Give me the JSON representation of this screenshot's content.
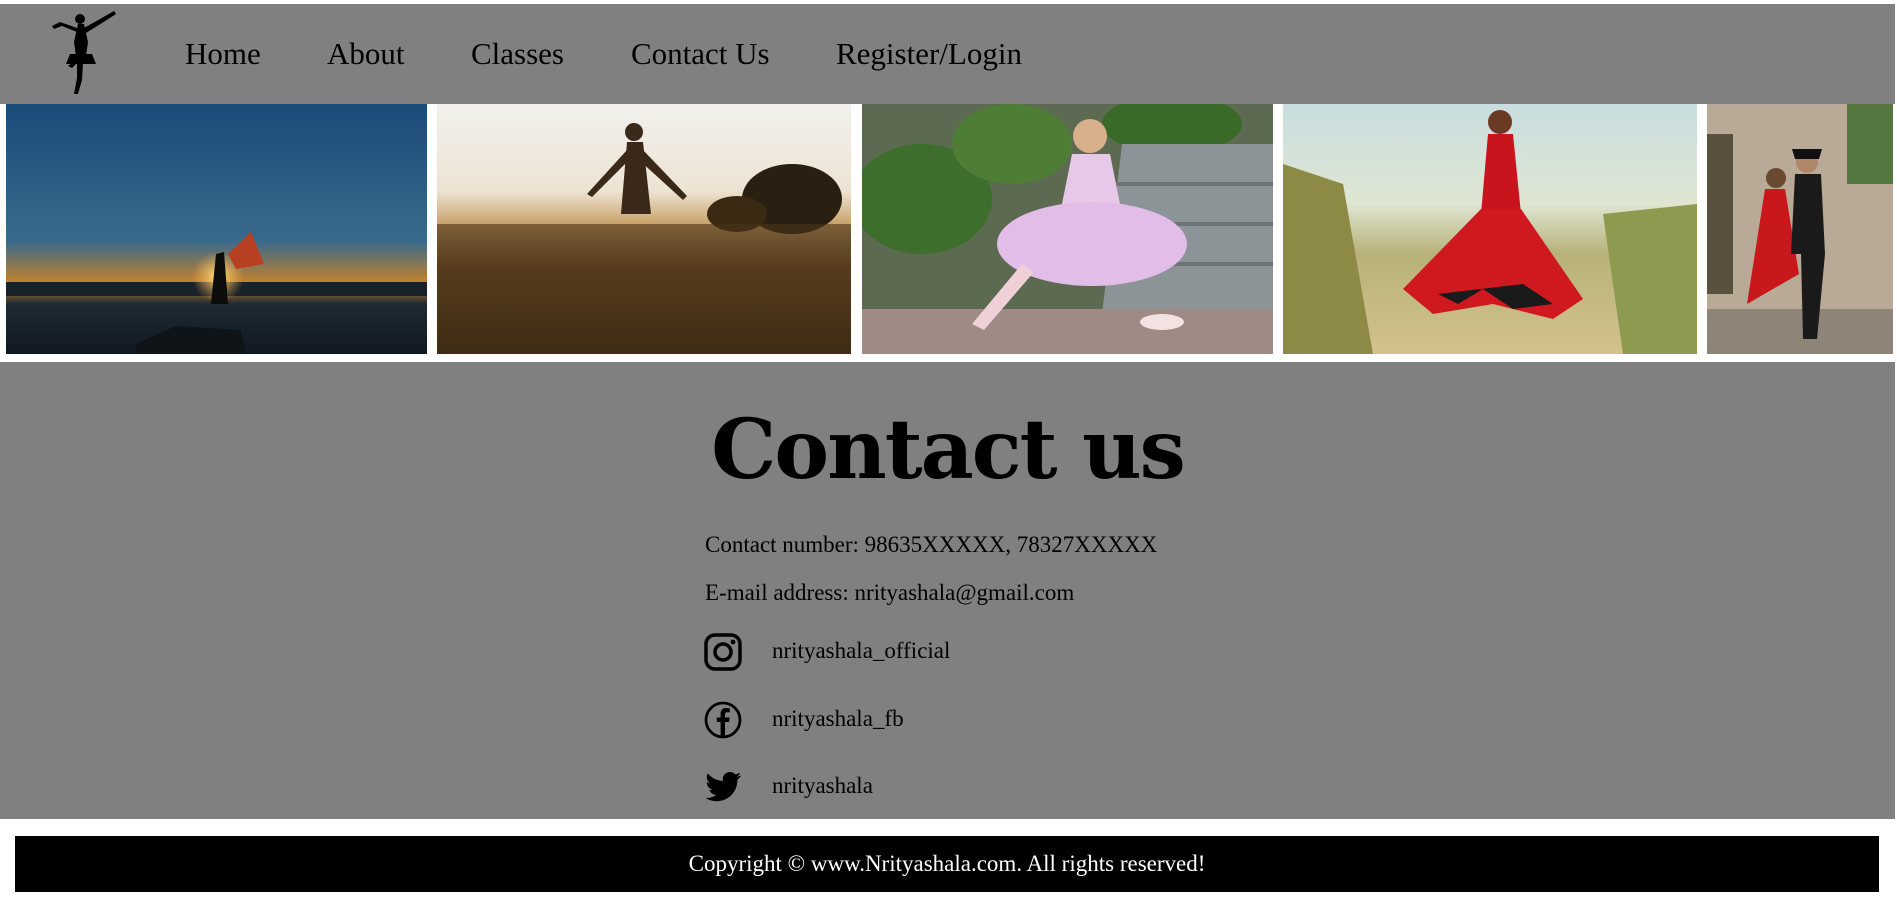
{
  "nav": {
    "items": [
      {
        "label": "Home"
      },
      {
        "label": "About"
      },
      {
        "label": "Classes"
      },
      {
        "label": "Contact Us"
      },
      {
        "label": "Register/Login"
      }
    ]
  },
  "gallery": {
    "photos": [
      {
        "name": "sunset-dancer-photo"
      },
      {
        "name": "field-dancer-photo"
      },
      {
        "name": "ballerina-child-photo"
      },
      {
        "name": "red-dress-dancer-photo"
      },
      {
        "name": "couple-dance-photo"
      }
    ]
  },
  "contact": {
    "title": "Contact us",
    "phone": "Contact number: 98635XXXXX, 78327XXXXX",
    "email": "E-mail address: nrityashala@gmail.com",
    "social": {
      "instagram": "nrityashala_official",
      "facebook": "nrityashala_fb",
      "twitter": "nrityashala"
    }
  },
  "footer": {
    "copyright": "Copyright © www.Nrityashala.com. All rights reserved!"
  },
  "colors": {
    "band": "#808080",
    "text": "#000000",
    "footer_bg": "#000000",
    "footer_text": "#ffffff"
  }
}
